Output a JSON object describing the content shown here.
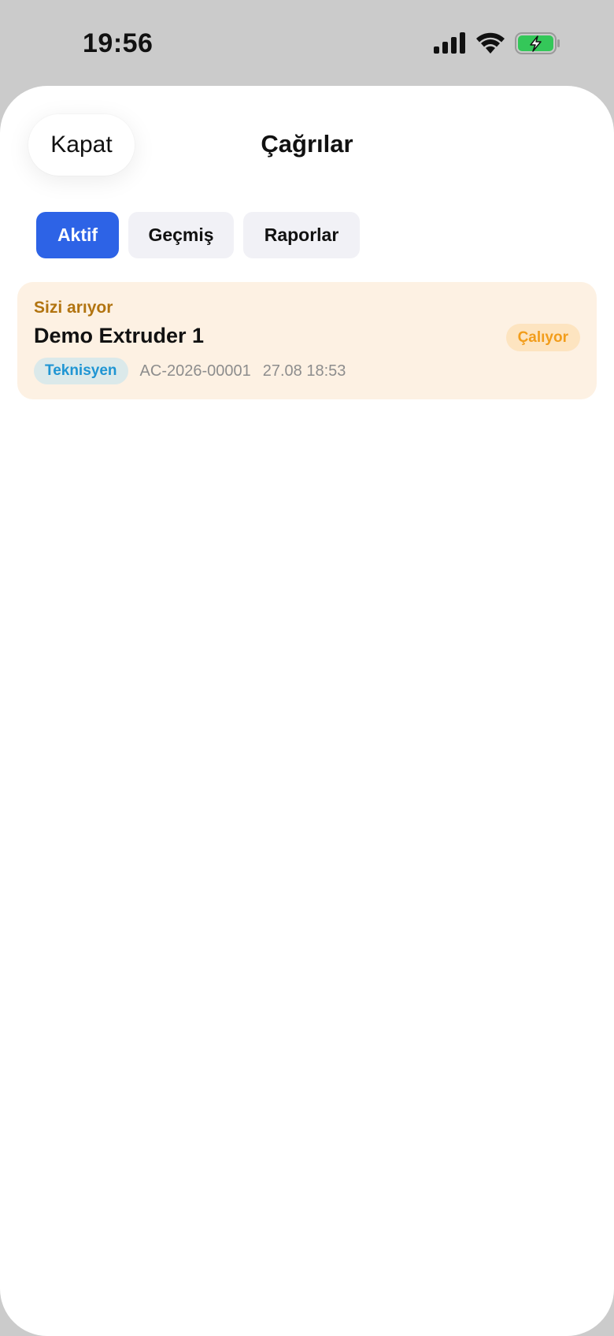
{
  "status_bar": {
    "time": "19:56",
    "icons": [
      "cellular-signal-icon",
      "wifi-icon",
      "battery-charging-icon"
    ],
    "battery_color": "#34c759"
  },
  "header": {
    "close_label": "Kapat",
    "title": "Çağrılar"
  },
  "tabs": [
    {
      "label": "Aktif",
      "active": true
    },
    {
      "label": "Geçmiş",
      "active": false
    },
    {
      "label": "Raporlar",
      "active": false
    }
  ],
  "calls": [
    {
      "subtitle": "Sizi arıyor",
      "title": "Demo Extruder 1",
      "status": "Çalıyor",
      "role": "Teknisyen",
      "code": "AC-2026-00001",
      "datetime": "27.08 18:53"
    }
  ],
  "colors": {
    "accent": "#2d63e6",
    "card_background": "#fdf1e3",
    "status_text": "#f29d1b",
    "subtitle_text": "#b27410",
    "role_text": "#1f95d3"
  }
}
